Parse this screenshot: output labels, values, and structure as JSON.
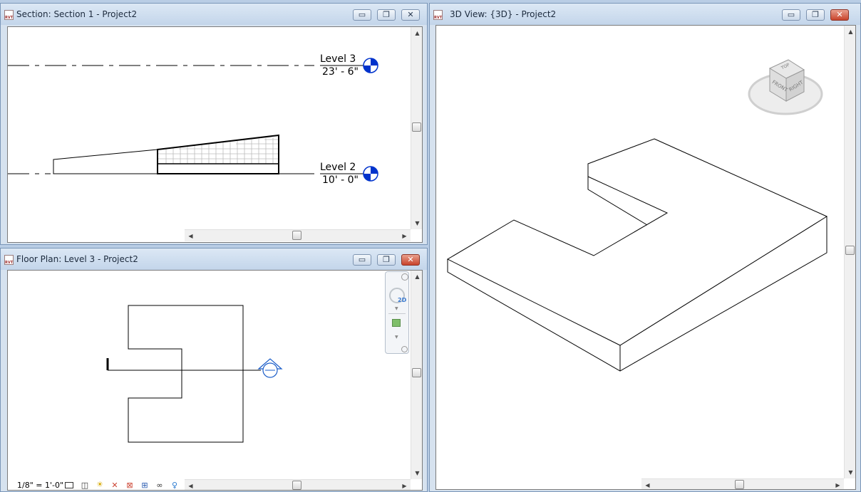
{
  "windows": {
    "section": {
      "title": "Section: Section 1 - Project2",
      "levels": [
        {
          "name": "Level 3",
          "elevation": "23' - 6\""
        },
        {
          "name": "Level 2",
          "elevation": "10' - 0\""
        }
      ]
    },
    "plan": {
      "title": "Floor Plan: Level 3 - Project2",
      "scale": "1/8\" = 1'-0\""
    },
    "view3d": {
      "title": "3D View: {3D} - Project2",
      "viewcube": {
        "top": "TOP",
        "front": "FRONT",
        "right": "RIGHT"
      }
    }
  },
  "icons": {
    "file": "RVT",
    "minimize": "▭",
    "restore": "❐",
    "close": "✕",
    "up": "▲",
    "down": "▼",
    "left": "◀",
    "right": "▶",
    "nav_2d": "2D"
  },
  "colors": {
    "accent_blue": "#0033cc",
    "close_red": "#c8432b"
  }
}
